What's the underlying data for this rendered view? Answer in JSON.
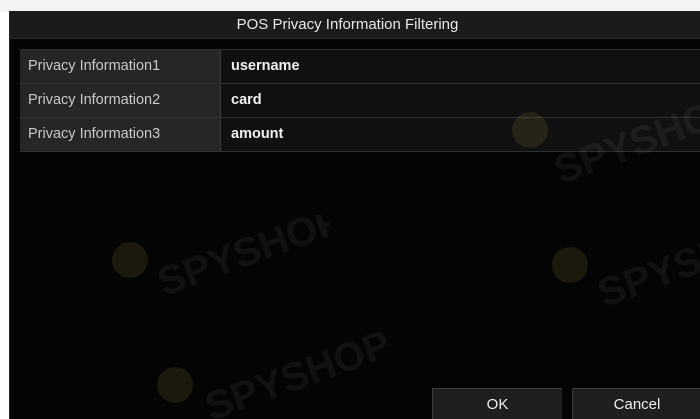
{
  "dialog": {
    "title": "POS Privacy Information Filtering",
    "rows": [
      {
        "label": "Privacy Information1",
        "value": "username"
      },
      {
        "label": "Privacy Information2",
        "value": "card"
      },
      {
        "label": "Privacy Information3",
        "value": "amount"
      }
    ],
    "buttons": {
      "ok_label": "OK",
      "cancel_label": "Cancel"
    }
  },
  "colors": {
    "dialog_background": "#040404",
    "title_bar": "#1b1b1b",
    "label_cell": "#262626",
    "value_cell": "#101010"
  },
  "watermark": {
    "text": "SPYSHOP"
  }
}
